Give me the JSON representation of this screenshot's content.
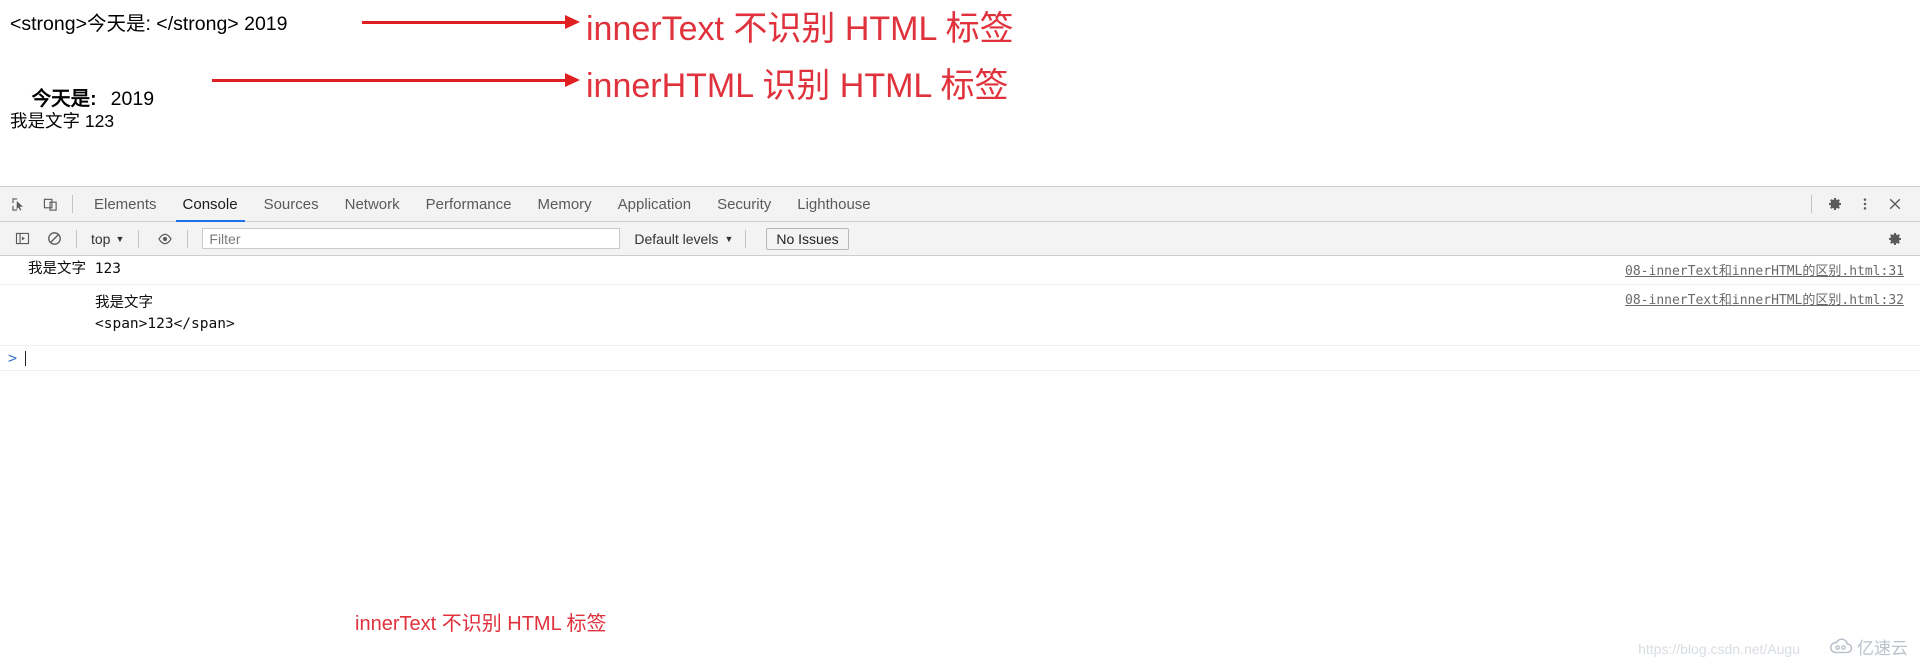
{
  "page": {
    "line1": "<strong>今天是: </strong> 2019",
    "line2_bold": "今天是:",
    "line2_rest": "2019",
    "line3": "我是文字 123"
  },
  "annotations": {
    "top1": "innerText 不识别 HTML 标签",
    "top2": "innerHTML 识别 HTML 标签",
    "bottom": "innerText 不识别 HTML 标签",
    "color": "#e0323c",
    "arrow_color": "#e02020"
  },
  "devtools": {
    "toolbar_icons": {
      "inspect": "inspect-element-icon",
      "device": "device-toolbar-icon",
      "settings": "gear-icon",
      "more": "more-options-icon",
      "close": "close-icon"
    },
    "tabs": [
      {
        "label": "Elements",
        "selected": false
      },
      {
        "label": "Console",
        "selected": true
      },
      {
        "label": "Sources",
        "selected": false
      },
      {
        "label": "Network",
        "selected": false
      },
      {
        "label": "Performance",
        "selected": false
      },
      {
        "label": "Memory",
        "selected": false
      },
      {
        "label": "Application",
        "selected": false
      },
      {
        "label": "Security",
        "selected": false
      },
      {
        "label": "Lighthouse",
        "selected": false
      }
    ],
    "selected_tab_accent": "#1a73e8",
    "console_toolbar": {
      "sidebar_icon": "console-sidebar-icon",
      "clear_icon": "clear-console-icon",
      "context": "top",
      "context_caret": "▼",
      "eye_icon": "live-expression-eye-icon",
      "filter_placeholder": "Filter",
      "filter_value": "",
      "levels": "Default levels",
      "levels_caret": "▼",
      "issues": "No Issues",
      "settings_icon": "console-settings-gear-icon"
    },
    "messages": [
      {
        "text_cjk": "我是文字",
        "text_rest": " 123",
        "source": "08-innerText和innerHTML的区别.html:31"
      },
      {
        "text_cjk": "我是文字",
        "text_rest": "\n<span>123</span>",
        "source": "08-innerText和innerHTML的区别.html:32"
      }
    ],
    "prompt": {
      "caret": ">"
    }
  },
  "watermarks": {
    "url": "https://blog.csdn.net/Augu",
    "logo_text": "亿速云"
  }
}
